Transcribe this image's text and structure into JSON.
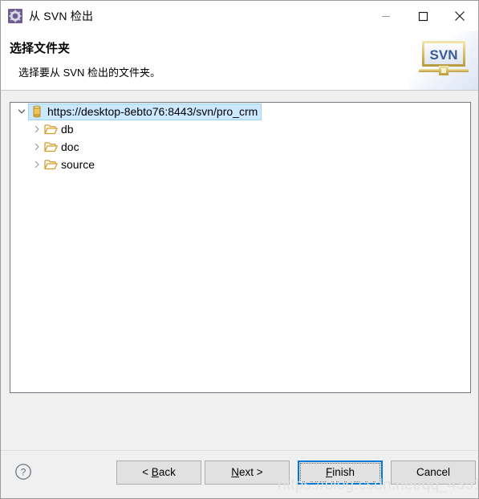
{
  "window": {
    "title": "从 SVN 检出",
    "icon": "svn-gear-icon",
    "controls": {
      "minimize": "minimize-icon",
      "maximize": "maximize-icon",
      "close": "close-icon"
    }
  },
  "header": {
    "title": "选择文件夹",
    "subtitle": "选择要从 SVN 检出的文件夹。",
    "banner_logo_text": "SVN"
  },
  "tree": {
    "root": {
      "label": "https://desktop-8ebto76:8443/svn/pro_crm",
      "icon": "repository-cylinder-icon",
      "expanded": true,
      "selected": true
    },
    "children": [
      {
        "label": "db",
        "icon": "folder-open-icon",
        "expanded": false
      },
      {
        "label": "doc",
        "icon": "folder-open-icon",
        "expanded": false
      },
      {
        "label": "source",
        "icon": "folder-open-icon",
        "expanded": false
      }
    ]
  },
  "footer": {
    "help": "?",
    "buttons": [
      {
        "label_pre": "< ",
        "label_key": "B",
        "label_post": "ack",
        "name": "back-button",
        "default": false
      },
      {
        "label_pre": "",
        "label_key": "N",
        "label_post": "ext >",
        "name": "next-button",
        "default": false
      },
      {
        "label_pre": "",
        "label_key": "F",
        "label_post": "inish",
        "name": "finish-button",
        "default": true
      },
      {
        "label_pre": "",
        "label_key": "",
        "label_post": "Cancel",
        "name": "cancel-button",
        "default": false
      }
    ]
  },
  "watermark": "https://blog.csdn.net/qq_43517653",
  "colors": {
    "accent": "#0078d7",
    "selection_fill": "#cce8ff",
    "selection_border": "#99d1ff",
    "button_face": "#e1e1e1",
    "dialog_face": "#f0f0f0",
    "folder": "#dfa233",
    "repo": "#e8b33a"
  }
}
